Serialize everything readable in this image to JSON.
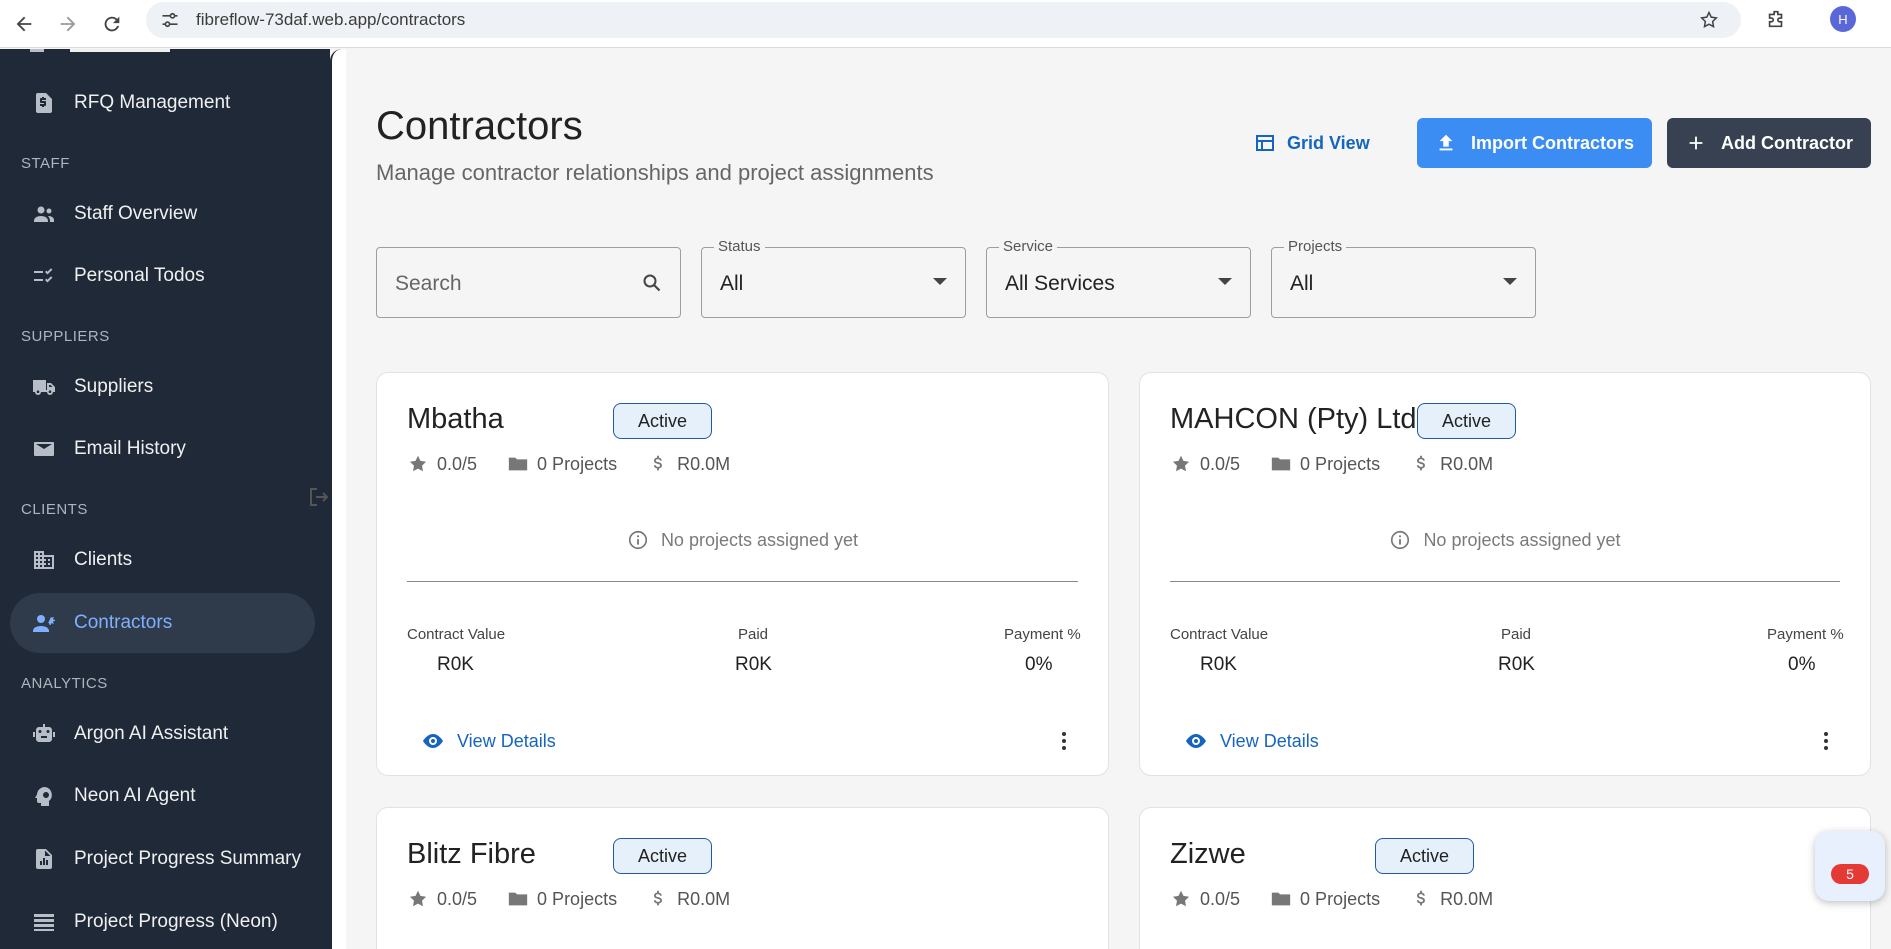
{
  "browser": {
    "url": "fibreflow-73daf.web.app/contractors",
    "profile_initial": "H"
  },
  "sidebar": {
    "items": [
      {
        "label": "RFQ Management",
        "icon": "request-quote-icon"
      },
      {
        "label": "Staff Overview",
        "icon": "people-icon"
      },
      {
        "label": "Personal Todos",
        "icon": "checklist-icon"
      },
      {
        "label": "Suppliers",
        "icon": "truck-icon"
      },
      {
        "label": "Email History",
        "icon": "mail-icon"
      },
      {
        "label": "Clients",
        "icon": "building-icon"
      },
      {
        "label": "Contractors",
        "icon": "engineering-icon"
      },
      {
        "label": "Argon AI Assistant",
        "icon": "robot-icon"
      },
      {
        "label": "Neon AI Agent",
        "icon": "psychology-icon"
      },
      {
        "label": "Project Progress Summary",
        "icon": "summary-icon"
      },
      {
        "label": "Project Progress (Neon)",
        "icon": "storage-icon"
      }
    ],
    "sections": {
      "staff": "STAFF",
      "suppliers": "SUPPLIERS",
      "clients": "CLIENTS",
      "analytics": "ANALYTICS"
    },
    "active_item": "Contractors"
  },
  "header": {
    "title": "Contractors",
    "subtitle": "Manage contractor relationships and project assignments",
    "grid_view_label": "Grid View",
    "import_label": "Import Contractors",
    "add_label": "Add Contractor"
  },
  "filters": {
    "search_placeholder": "Search",
    "status_label": "Status",
    "status_value": "All",
    "service_label": "Service",
    "service_value": "All Services",
    "projects_label": "Projects",
    "projects_value": "All"
  },
  "cards": [
    {
      "name": "Mbatha",
      "status": "Active",
      "rating": "0.0/5",
      "projects": "0 Projects",
      "value": "R0.0M",
      "empty_text": "No projects assigned yet",
      "contract_value_label": "Contract Value",
      "contract_value": "R0K",
      "paid_label": "Paid",
      "paid": "R0K",
      "payment_label": "Payment %",
      "payment": "0%",
      "view_label": "View Details"
    },
    {
      "name": "MAHCON (Pty) Ltd",
      "status": "Active",
      "rating": "0.0/5",
      "projects": "0 Projects",
      "value": "R0.0M",
      "empty_text": "No projects assigned yet",
      "contract_value_label": "Contract Value",
      "contract_value": "R0K",
      "paid_label": "Paid",
      "paid": "R0K",
      "payment_label": "Payment %",
      "payment": "0%",
      "view_label": "View Details"
    },
    {
      "name": "Blitz Fibre",
      "status": "Active",
      "rating": "0.0/5",
      "projects": "0 Projects",
      "value": "R0.0M"
    },
    {
      "name": "Zizwe",
      "status": "Active",
      "rating": "0.0/5",
      "projects": "0 Projects",
      "value": "R0.0M"
    }
  ],
  "notification": {
    "count": "5"
  },
  "colors": {
    "sidebar_bg": "#1f2937",
    "accent_blue": "#3b8cf3",
    "link_blue": "#1565c0",
    "dark_button": "#374151",
    "active_item_text": "#7fb0ff"
  }
}
